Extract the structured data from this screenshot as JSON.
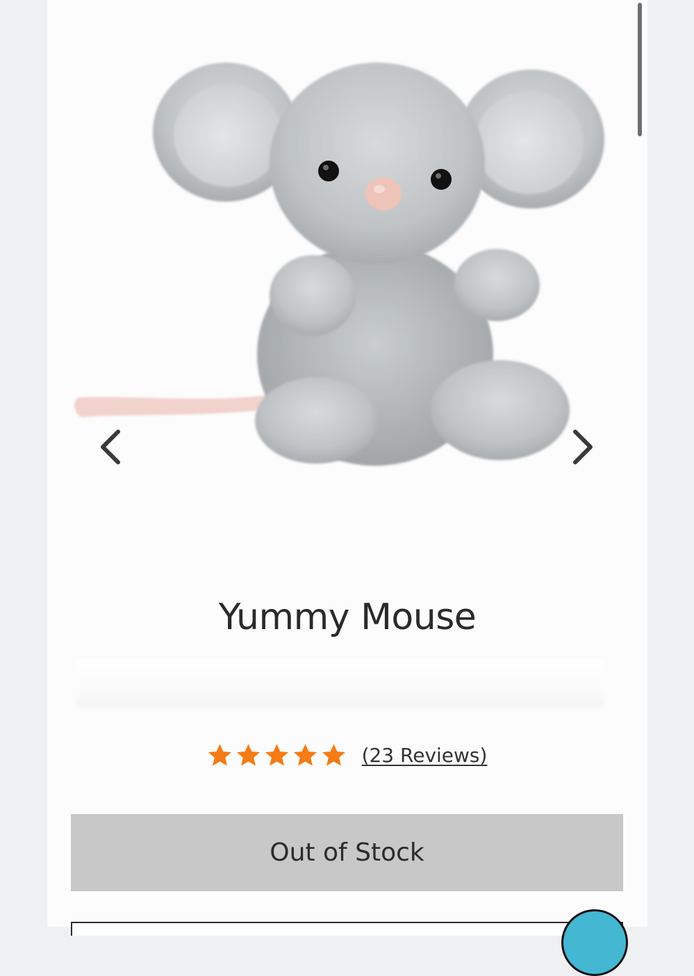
{
  "product": {
    "title": "Yummy Mouse",
    "image_subject": "grey plush mouse toy with pink nose and tail",
    "rating": {
      "stars": 5,
      "max_stars": 5,
      "reviews_label": "(23 Reviews)"
    },
    "stock_button_label": "Out of Stock"
  },
  "gallery": {
    "prev_icon": "chevron-left-icon",
    "next_icon": "chevron-right-icon"
  },
  "colors": {
    "star": "#f47b16",
    "button_bg": "#c8c8c8",
    "chat_bubble": "#44b7d2"
  }
}
